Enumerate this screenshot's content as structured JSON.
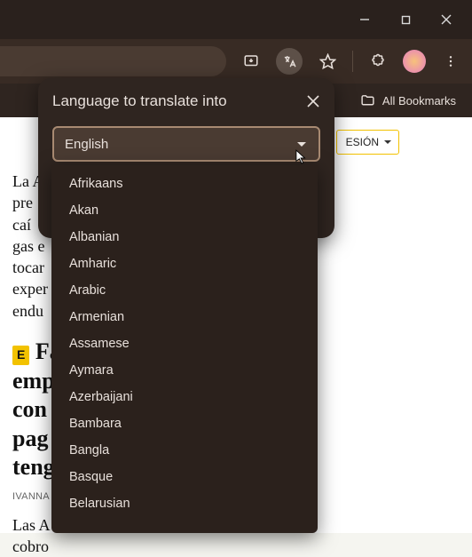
{
  "window": {
    "buttons": {
      "min": "minimize",
      "max": "maximize",
      "close": "close"
    }
  },
  "toolbar": {
    "install_icon": "install",
    "translate_icon": "translate",
    "star_icon": "star",
    "extensions_icon": "extensions",
    "menu_icon": "menu"
  },
  "bookmarks_bar": {
    "all_label": "All Bookmarks"
  },
  "page": {
    "session_button": "ESIÓN",
    "article1_text": "La A\npre\ncaí\ngas e\ntocar\nexper\nendu",
    "article2_badge": "E",
    "article2_badge_after": " Fa",
    "article2_headline": "emp\ncon\npag\nteng",
    "article2_byline": "IVANNA V",
    "article2_body": "Las A\ncobro"
  },
  "translate_popup": {
    "title": "Language to translate into",
    "selected": "English"
  },
  "languages": [
    "Afrikaans",
    "Akan",
    "Albanian",
    "Amharic",
    "Arabic",
    "Armenian",
    "Assamese",
    "Aymara",
    "Azerbaijani",
    "Bambara",
    "Bangla",
    "Basque",
    "Belarusian"
  ]
}
